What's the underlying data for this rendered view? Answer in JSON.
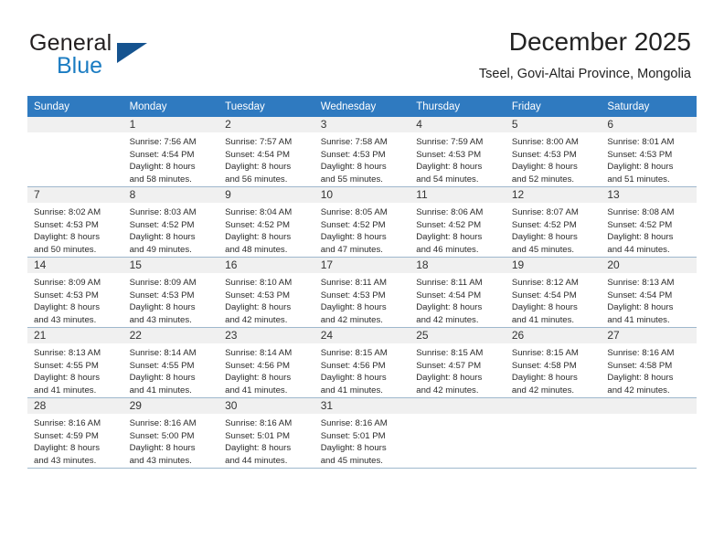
{
  "brand": {
    "name_part1": "General",
    "name_part2": "Blue",
    "accent_color": "#1b7cc2",
    "triangle_color": "#15538f"
  },
  "header": {
    "title": "December 2025",
    "subtitle": "Tseel, Govi-Altai Province, Mongolia"
  },
  "calendar": {
    "header_bg": "#2f7ac0",
    "weekday_headers": [
      "Sunday",
      "Monday",
      "Tuesday",
      "Wednesday",
      "Thursday",
      "Friday",
      "Saturday"
    ],
    "weeks": [
      [
        {
          "day": "",
          "lines": []
        },
        {
          "day": "1",
          "lines": [
            "Sunrise: 7:56 AM",
            "Sunset: 4:54 PM",
            "Daylight: 8 hours",
            "and 58 minutes."
          ]
        },
        {
          "day": "2",
          "lines": [
            "Sunrise: 7:57 AM",
            "Sunset: 4:54 PM",
            "Daylight: 8 hours",
            "and 56 minutes."
          ]
        },
        {
          "day": "3",
          "lines": [
            "Sunrise: 7:58 AM",
            "Sunset: 4:53 PM",
            "Daylight: 8 hours",
            "and 55 minutes."
          ]
        },
        {
          "day": "4",
          "lines": [
            "Sunrise: 7:59 AM",
            "Sunset: 4:53 PM",
            "Daylight: 8 hours",
            "and 54 minutes."
          ]
        },
        {
          "day": "5",
          "lines": [
            "Sunrise: 8:00 AM",
            "Sunset: 4:53 PM",
            "Daylight: 8 hours",
            "and 52 minutes."
          ]
        },
        {
          "day": "6",
          "lines": [
            "Sunrise: 8:01 AM",
            "Sunset: 4:53 PM",
            "Daylight: 8 hours",
            "and 51 minutes."
          ]
        }
      ],
      [
        {
          "day": "7",
          "lines": [
            "Sunrise: 8:02 AM",
            "Sunset: 4:53 PM",
            "Daylight: 8 hours",
            "and 50 minutes."
          ]
        },
        {
          "day": "8",
          "lines": [
            "Sunrise: 8:03 AM",
            "Sunset: 4:52 PM",
            "Daylight: 8 hours",
            "and 49 minutes."
          ]
        },
        {
          "day": "9",
          "lines": [
            "Sunrise: 8:04 AM",
            "Sunset: 4:52 PM",
            "Daylight: 8 hours",
            "and 48 minutes."
          ]
        },
        {
          "day": "10",
          "lines": [
            "Sunrise: 8:05 AM",
            "Sunset: 4:52 PM",
            "Daylight: 8 hours",
            "and 47 minutes."
          ]
        },
        {
          "day": "11",
          "lines": [
            "Sunrise: 8:06 AM",
            "Sunset: 4:52 PM",
            "Daylight: 8 hours",
            "and 46 minutes."
          ]
        },
        {
          "day": "12",
          "lines": [
            "Sunrise: 8:07 AM",
            "Sunset: 4:52 PM",
            "Daylight: 8 hours",
            "and 45 minutes."
          ]
        },
        {
          "day": "13",
          "lines": [
            "Sunrise: 8:08 AM",
            "Sunset: 4:52 PM",
            "Daylight: 8 hours",
            "and 44 minutes."
          ]
        }
      ],
      [
        {
          "day": "14",
          "lines": [
            "Sunrise: 8:09 AM",
            "Sunset: 4:53 PM",
            "Daylight: 8 hours",
            "and 43 minutes."
          ]
        },
        {
          "day": "15",
          "lines": [
            "Sunrise: 8:09 AM",
            "Sunset: 4:53 PM",
            "Daylight: 8 hours",
            "and 43 minutes."
          ]
        },
        {
          "day": "16",
          "lines": [
            "Sunrise: 8:10 AM",
            "Sunset: 4:53 PM",
            "Daylight: 8 hours",
            "and 42 minutes."
          ]
        },
        {
          "day": "17",
          "lines": [
            "Sunrise: 8:11 AM",
            "Sunset: 4:53 PM",
            "Daylight: 8 hours",
            "and 42 minutes."
          ]
        },
        {
          "day": "18",
          "lines": [
            "Sunrise: 8:11 AM",
            "Sunset: 4:54 PM",
            "Daylight: 8 hours",
            "and 42 minutes."
          ]
        },
        {
          "day": "19",
          "lines": [
            "Sunrise: 8:12 AM",
            "Sunset: 4:54 PM",
            "Daylight: 8 hours",
            "and 41 minutes."
          ]
        },
        {
          "day": "20",
          "lines": [
            "Sunrise: 8:13 AM",
            "Sunset: 4:54 PM",
            "Daylight: 8 hours",
            "and 41 minutes."
          ]
        }
      ],
      [
        {
          "day": "21",
          "lines": [
            "Sunrise: 8:13 AM",
            "Sunset: 4:55 PM",
            "Daylight: 8 hours",
            "and 41 minutes."
          ]
        },
        {
          "day": "22",
          "lines": [
            "Sunrise: 8:14 AM",
            "Sunset: 4:55 PM",
            "Daylight: 8 hours",
            "and 41 minutes."
          ]
        },
        {
          "day": "23",
          "lines": [
            "Sunrise: 8:14 AM",
            "Sunset: 4:56 PM",
            "Daylight: 8 hours",
            "and 41 minutes."
          ]
        },
        {
          "day": "24",
          "lines": [
            "Sunrise: 8:15 AM",
            "Sunset: 4:56 PM",
            "Daylight: 8 hours",
            "and 41 minutes."
          ]
        },
        {
          "day": "25",
          "lines": [
            "Sunrise: 8:15 AM",
            "Sunset: 4:57 PM",
            "Daylight: 8 hours",
            "and 42 minutes."
          ]
        },
        {
          "day": "26",
          "lines": [
            "Sunrise: 8:15 AM",
            "Sunset: 4:58 PM",
            "Daylight: 8 hours",
            "and 42 minutes."
          ]
        },
        {
          "day": "27",
          "lines": [
            "Sunrise: 8:16 AM",
            "Sunset: 4:58 PM",
            "Daylight: 8 hours",
            "and 42 minutes."
          ]
        }
      ],
      [
        {
          "day": "28",
          "lines": [
            "Sunrise: 8:16 AM",
            "Sunset: 4:59 PM",
            "Daylight: 8 hours",
            "and 43 minutes."
          ]
        },
        {
          "day": "29",
          "lines": [
            "Sunrise: 8:16 AM",
            "Sunset: 5:00 PM",
            "Daylight: 8 hours",
            "and 43 minutes."
          ]
        },
        {
          "day": "30",
          "lines": [
            "Sunrise: 8:16 AM",
            "Sunset: 5:01 PM",
            "Daylight: 8 hours",
            "and 44 minutes."
          ]
        },
        {
          "day": "31",
          "lines": [
            "Sunrise: 8:16 AM",
            "Sunset: 5:01 PM",
            "Daylight: 8 hours",
            "and 45 minutes."
          ]
        },
        {
          "day": "",
          "lines": []
        },
        {
          "day": "",
          "lines": []
        },
        {
          "day": "",
          "lines": []
        }
      ]
    ]
  }
}
